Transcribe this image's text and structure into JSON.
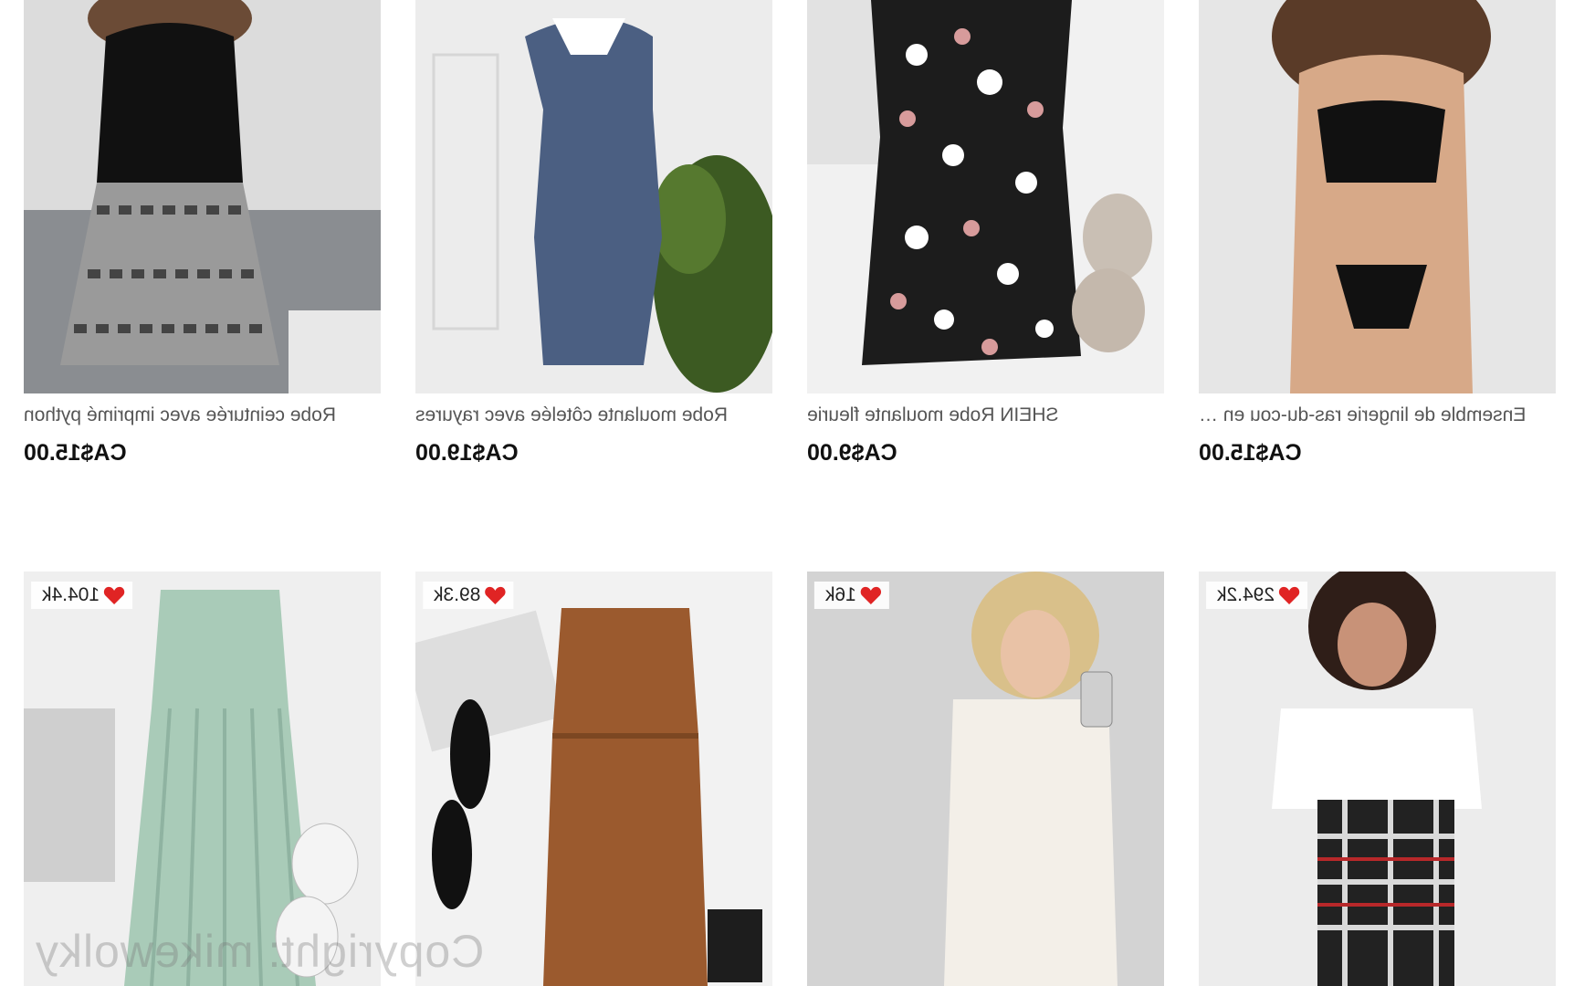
{
  "products_row1": [
    {
      "title": "Robe ceinturée avec imprimé python",
      "price": "CA$15.00",
      "image": "black-top-python-skirt-photo"
    },
    {
      "title": "Robe moulante côtelée avec rayures",
      "price": "CA$19.00",
      "image": "navy-polo-dress-photo"
    },
    {
      "title": "SHEIN Robe moulante fleurie",
      "price": "CA$9.00",
      "image": "floral-dress-flatlay-photo"
    },
    {
      "title": "Ensemble de lingerie ras-du-cou en …",
      "price": "CA$15.00",
      "image": "black-lingerie-set-photo"
    }
  ],
  "products_row2": [
    {
      "likes": "104.4k",
      "image": "mint-ribbed-dress-flatlay-photo"
    },
    {
      "likes": "89.3k",
      "image": "brown-ribbed-dress-flatlay-photo"
    },
    {
      "likes": "16k",
      "image": "white-ribbed-polo-dress-photo"
    },
    {
      "likes": "294.2k",
      "image": "plaid-overall-dress-photo"
    }
  ],
  "watermark": "Copyright: mikewolky",
  "colors": {
    "heart": "#e02424",
    "price": "#111111",
    "title": "#555555"
  }
}
